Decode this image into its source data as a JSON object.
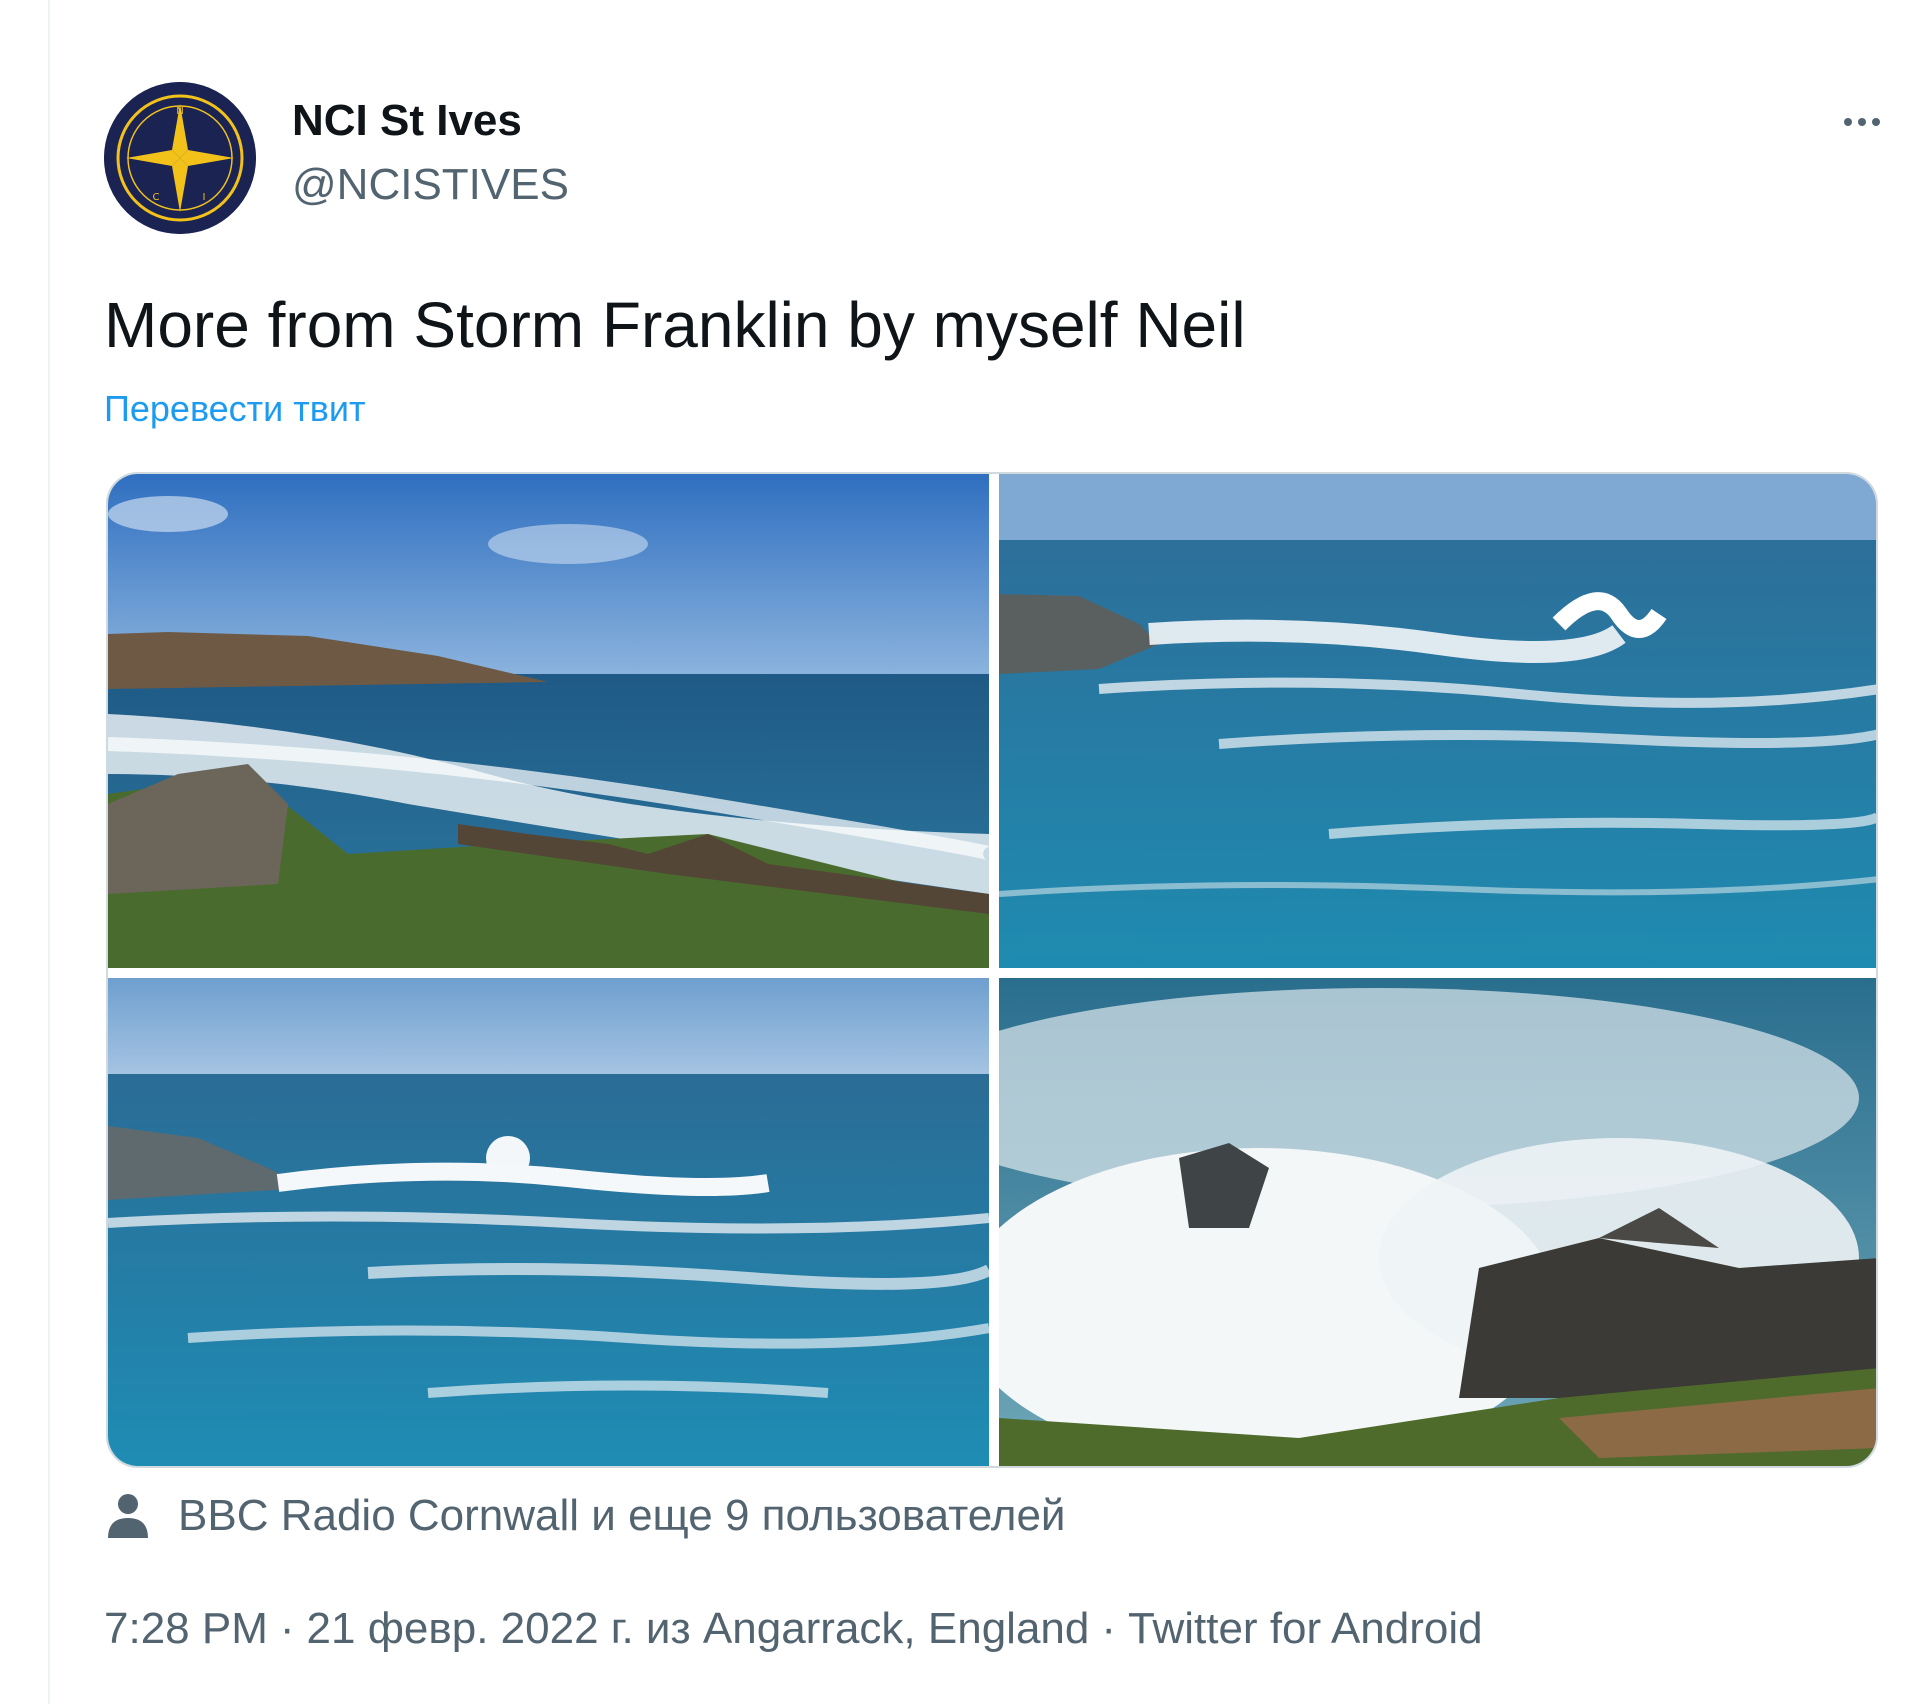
{
  "tweet": {
    "author": {
      "display_name": "NCI St Ives",
      "handle": "@NCISTIVES",
      "avatar_icon": "nci-compass-logo",
      "avatar_colors": {
        "background": "#1a2352",
        "accent": "#f2c21b"
      }
    },
    "more_icon": "more-horizontal-icon",
    "text": "More from Storm Franklin by myself Neil",
    "translate_label": "Перевести твит",
    "media": [
      {
        "description_icon": "photo-coast-headland"
      },
      {
        "description_icon": "photo-rough-sea-rocks"
      },
      {
        "description_icon": "photo-breaking-waves"
      },
      {
        "description_icon": "photo-spray-on-rocks"
      }
    ],
    "tagged_icon": "person-icon",
    "tagged_text": "BBC Radio Cornwall и еще 9 пользователей",
    "time": "7:28 PM",
    "date": "21 февр. 2022 г.",
    "location": "из Angarrack, England",
    "source": "Twitter for Android",
    "separator": "·"
  },
  "colors": {
    "text_primary": "#0f1419",
    "text_secondary": "#536471",
    "link": "#1d9bf0",
    "border": "#cfd9de"
  }
}
